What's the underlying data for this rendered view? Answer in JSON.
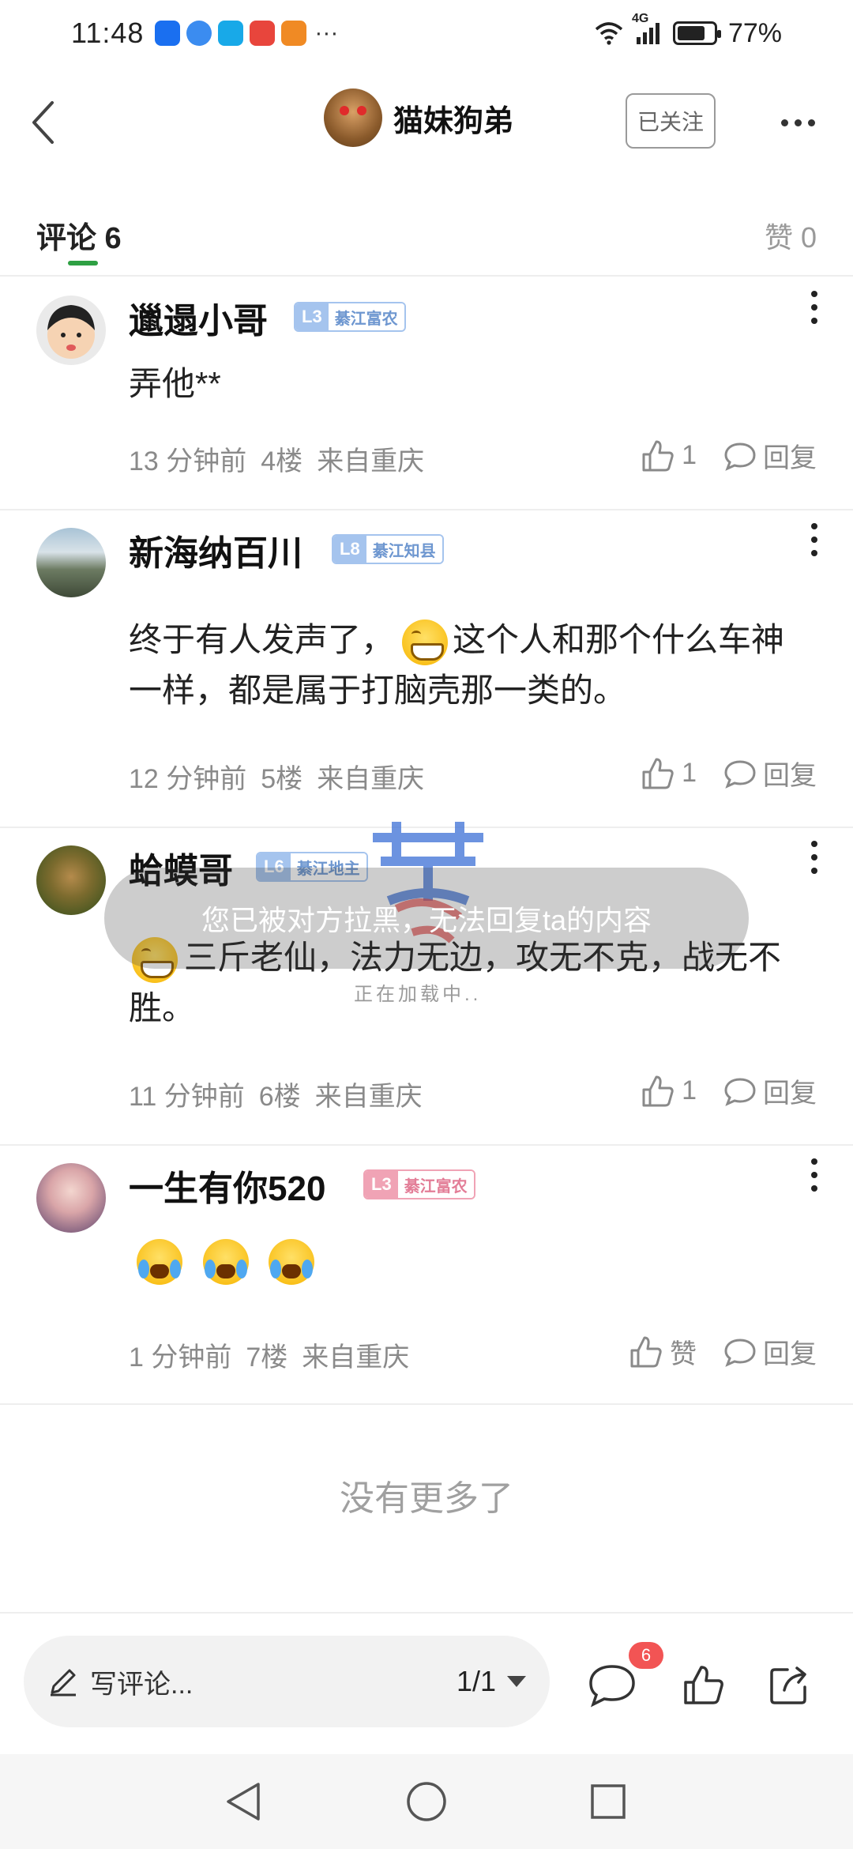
{
  "status_bar": {
    "time": "11:48",
    "more": "···",
    "network": "4G",
    "battery": "77%",
    "battery_level": 0.77
  },
  "header": {
    "title": "猫妹狗弟",
    "follow_label": "已关注"
  },
  "tabs": {
    "comments_label": "评论 6",
    "likes_label": "赞 0"
  },
  "comments": [
    {
      "name": "邋遢小哥",
      "level": "L3",
      "title": "綦江富农",
      "badge_color": "blue",
      "text": "弄他**",
      "time": "13 分钟前",
      "floor": "4楼",
      "location": "来自重庆",
      "likes": "1",
      "reply_label": "回复"
    },
    {
      "name": "新海纳百川",
      "level": "L8",
      "title": "綦江知县",
      "badge_color": "blue",
      "text_before": "终于有人发声了，",
      "text_after": "这个人和那个什么车神一样，都是属于打脑壳那一类的。",
      "time": "12 分钟前",
      "floor": "5楼",
      "location": "来自重庆",
      "likes": "1",
      "reply_label": "回复"
    },
    {
      "name": "蛤蟆哥",
      "level": "L6",
      "title": "綦江地主",
      "badge_color": "blue",
      "text_after": "三斤老仙，法力无边，攻无不克，战无不胜。",
      "time": "11 分钟前",
      "floor": "6楼",
      "location": "来自重庆",
      "likes": "1",
      "reply_label": "回复"
    },
    {
      "name": "一生有你520",
      "level": "L3",
      "title": "綦江富农",
      "badge_color": "pink",
      "time": "1 分钟前",
      "floor": "7楼",
      "location": "来自重庆",
      "likes": "赞",
      "reply_label": "回复"
    }
  ],
  "toast": {
    "message": "您已被对方拉黑，无法回复ta的内容",
    "loading": "正在加载中.."
  },
  "footer": {
    "no_more": "没有更多了"
  },
  "bottom_bar": {
    "placeholder": "写评论...",
    "page": "1/1",
    "comment_count": "6"
  },
  "colors": {
    "accent_green": "#2ea043",
    "badge_blue": "#a5c4ee",
    "badge_pink": "#f0a3b5",
    "count_red": "#f25454"
  },
  "icons": [
    "back-icon",
    "more-icon",
    "kebab-icon",
    "thumbs-up-icon",
    "reply-bubble-icon",
    "pencil-icon",
    "caret-down-icon",
    "comment-icon",
    "like-icon",
    "share-icon",
    "nav-back-icon",
    "nav-home-icon",
    "nav-recents-icon"
  ]
}
